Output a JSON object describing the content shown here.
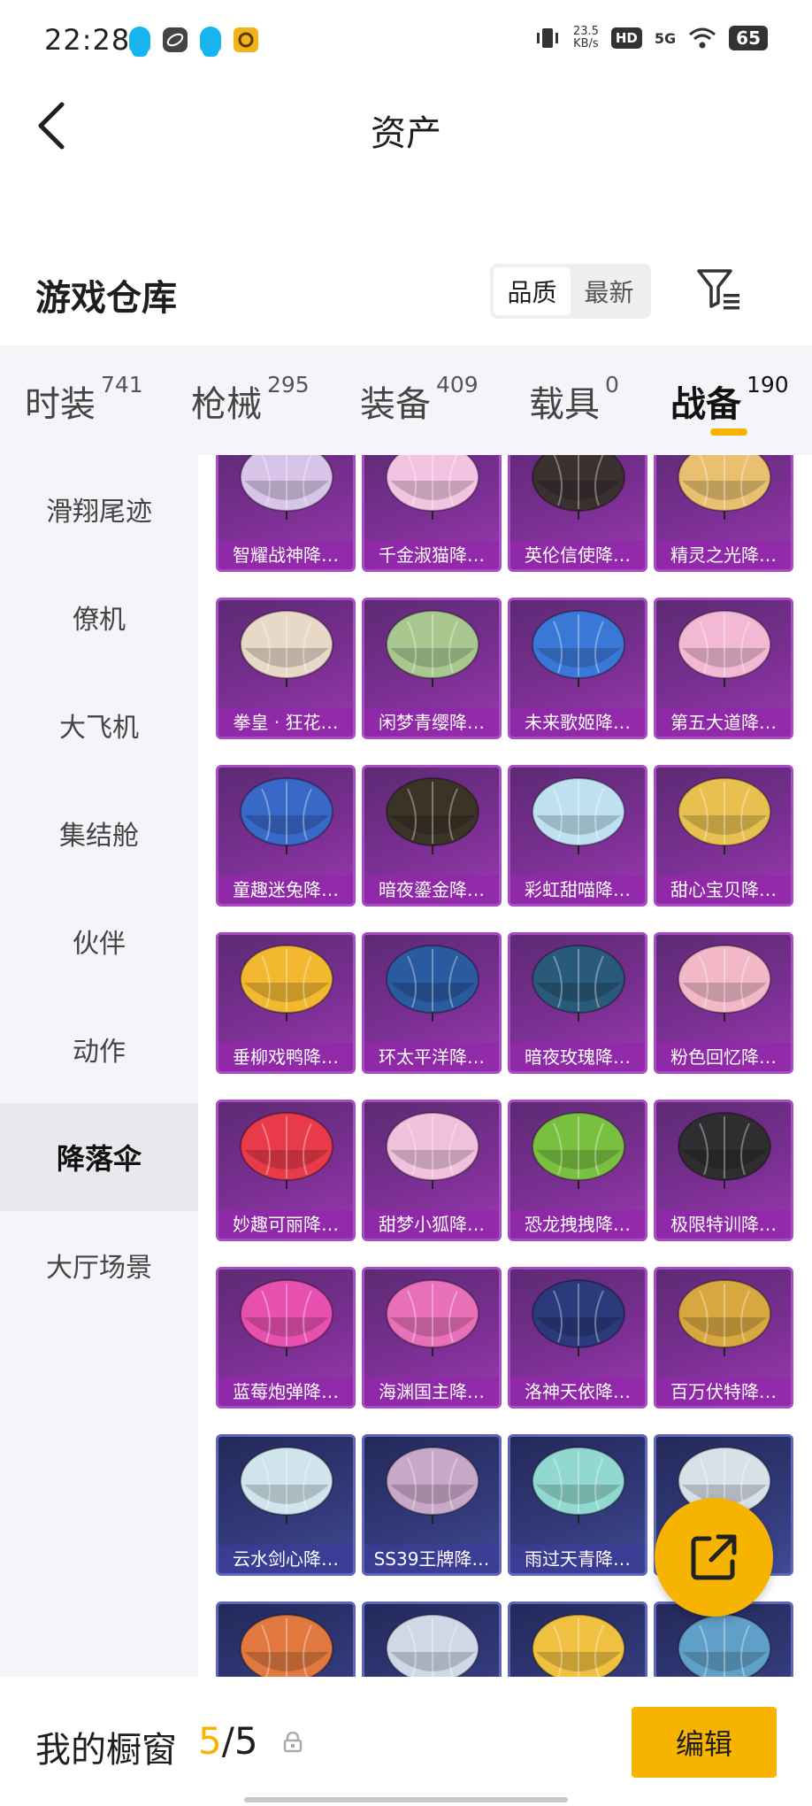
{
  "status_bar": {
    "time": "22:28",
    "speed_value": "23.5",
    "speed_unit": "KB/s",
    "hd": "HD",
    "network": "5G",
    "battery": "65"
  },
  "header": {
    "title": "资产",
    "back_icon": "chevron-left-icon"
  },
  "warehouse": {
    "title": "游戏仓库",
    "sort_options": [
      "品质",
      "最新"
    ],
    "sort_selected": "品质",
    "filter_icon": "filter-list-icon"
  },
  "tabs": [
    {
      "label": "时装",
      "count": "741"
    },
    {
      "label": "枪械",
      "count": "295"
    },
    {
      "label": "装备",
      "count": "409"
    },
    {
      "label": "载具",
      "count": "0"
    },
    {
      "label": "战备",
      "count": "190"
    }
  ],
  "active_tab": "战备",
  "sidenav": [
    "滑翔尾迹",
    "僚机",
    "大飞机",
    "集结舱",
    "伙伴",
    "动作",
    "降落伞",
    "大厅场景"
  ],
  "sidenav_active": "降落伞",
  "items": [
    {
      "label": "智耀战神降…",
      "color": "#d7c4e8"
    },
    {
      "label": "千金淑猫降…",
      "color": "#f2c4e2"
    },
    {
      "label": "英伦信使降…",
      "color": "#3a3030"
    },
    {
      "label": "精灵之光降…",
      "color": "#e8c070"
    },
    {
      "label": "拳皇 · 狂花…",
      "color": "#e8d8c8"
    },
    {
      "label": "闲梦青缨降…",
      "color": "#a8c890"
    },
    {
      "label": "未来歌姬降…",
      "color": "#3a78d8"
    },
    {
      "label": "第五大道降…",
      "color": "#f2b8d4"
    },
    {
      "label": "童趣迷兔降…",
      "color": "#3868c8"
    },
    {
      "label": "暗夜鎏金降…",
      "color": "#3a3326"
    },
    {
      "label": "彩虹甜喵降…",
      "color": "#bfe0f0"
    },
    {
      "label": "甜心宝贝降…",
      "color": "#e8c050"
    },
    {
      "label": "垂柳戏鸭降…",
      "color": "#f2b830"
    },
    {
      "label": "环太平洋降…",
      "color": "#2a5aa0"
    },
    {
      "label": "暗夜玫瑰降…",
      "color": "#2a5a7a"
    },
    {
      "label": "粉色回忆降…",
      "color": "#f2b8c8"
    },
    {
      "label": "妙趣可丽降…",
      "color": "#e83a48"
    },
    {
      "label": "甜梦小狐降…",
      "color": "#f0c0dc"
    },
    {
      "label": "恐龙拽拽降…",
      "color": "#7ac040"
    },
    {
      "label": "极限特训降…",
      "color": "#2e2e30"
    },
    {
      "label": "蓝莓炮弹降…",
      "color": "#e850b0"
    },
    {
      "label": "海渊国主降…",
      "color": "#e870b8"
    },
    {
      "label": "洛神天依降…",
      "color": "#2a3a7a"
    },
    {
      "label": "百万伏特降…",
      "color": "#d8a840"
    },
    {
      "label": "云水剑心降…",
      "color": "#d0e4ec"
    },
    {
      "label": "SS39王牌降…",
      "color": "#c8a8c8"
    },
    {
      "label": "雨过天青降…",
      "color": "#90d8d0"
    },
    {
      "label": "",
      "color": "#d8e0e8"
    },
    {
      "label": "",
      "color": "#e07840"
    },
    {
      "label": "",
      "color": "#d0d8e8"
    },
    {
      "label": "",
      "color": "#f0c040"
    },
    {
      "label": "",
      "color": "#60a0c8"
    }
  ],
  "share_icon": "share-external-icon",
  "showcase": {
    "label": "我的橱窗",
    "current": "5",
    "separator": "/",
    "total": "5",
    "lock_icon": "lock-icon",
    "edit_label": "编辑"
  }
}
